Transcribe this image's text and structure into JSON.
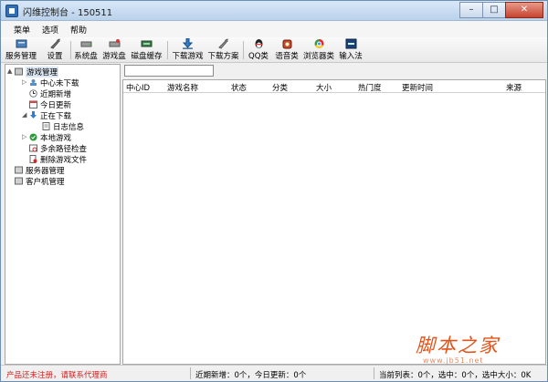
{
  "window": {
    "title": "闪维控制台 - 150511",
    "min": "–",
    "max": "□",
    "close": "✕"
  },
  "menu": [
    "菜单",
    "选项",
    "帮助"
  ],
  "toolbar": [
    {
      "label": "服务管理",
      "icon": "server-manage-icon"
    },
    {
      "label": "设置",
      "icon": "wrench-icon"
    },
    {
      "label": "系统盘",
      "icon": "disk-icon"
    },
    {
      "label": "游戏盘",
      "icon": "game-disk-icon"
    },
    {
      "label": "磁盘缓存",
      "icon": "cache-icon"
    },
    {
      "label": "下载游戏",
      "icon": "download-icon"
    },
    {
      "label": "下载方案",
      "icon": "plan-icon"
    },
    {
      "label": "QQ类",
      "icon": "qq-icon"
    },
    {
      "label": "语音类",
      "icon": "voice-icon"
    },
    {
      "label": "浏览器类",
      "icon": "browser-icon"
    },
    {
      "label": "输入法",
      "icon": "ime-icon"
    }
  ],
  "tree": [
    {
      "label": "游戏管理",
      "level": 0,
      "icon": "game-manage-icon",
      "expander": "▲"
    },
    {
      "label": "中心未下载",
      "level": 1,
      "icon": "center-icon",
      "expander": "▷"
    },
    {
      "label": "近期新增",
      "level": 1,
      "icon": "recent-icon",
      "expander": ""
    },
    {
      "label": "今日更新",
      "level": 1,
      "icon": "calendar-icon",
      "expander": ""
    },
    {
      "label": "正在下载",
      "level": 1,
      "icon": "downloading-icon",
      "expander": "◢"
    },
    {
      "label": "日志信息",
      "level": 2,
      "icon": "log-icon",
      "expander": ""
    },
    {
      "label": "本地游戏",
      "level": 1,
      "icon": "local-game-icon",
      "expander": "▷"
    },
    {
      "label": "多余路径检查",
      "level": 1,
      "icon": "path-check-icon",
      "expander": ""
    },
    {
      "label": "删除游戏文件",
      "level": 1,
      "icon": "delete-file-icon",
      "expander": ""
    },
    {
      "label": "服务器管理",
      "level": 0,
      "icon": "server-icon",
      "expander": ""
    },
    {
      "label": "客户机管理",
      "level": 0,
      "icon": "client-icon",
      "expander": ""
    }
  ],
  "search": {
    "value": "",
    "placeholder": ""
  },
  "columns": [
    "中心ID",
    "游戏名称",
    "状态",
    "分类",
    "大小",
    "热门度",
    "更新时间",
    "来源"
  ],
  "status": {
    "warning": "产品还未注册，请联系代理商",
    "recent": "近期新增：0个，今日更新：0个",
    "list": "当前列表：0个，选中：0个，选中大小：0K"
  },
  "watermark": {
    "main": "脚本之家",
    "sub": "www.jb51.net"
  },
  "colors": {
    "warning": "#d41f1f",
    "watermark": "#e2541c",
    "title_bg": "#c9dcf0"
  }
}
